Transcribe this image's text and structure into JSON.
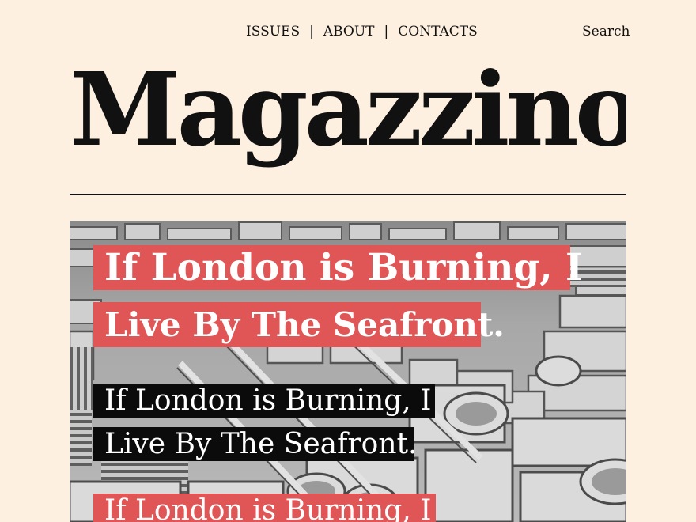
{
  "nav": {
    "links": [
      "ISSUES",
      "ABOUT",
      "CONTACTS"
    ],
    "separator": "|",
    "search_label": "Search"
  },
  "brand": {
    "title": "Magazzino"
  },
  "article": {
    "headline_line1": "If London is Burning, I",
    "headline_line2": "Live By The Seafront."
  },
  "colors": {
    "background": "#fdf0e0",
    "highlight_red": "#e05656",
    "highlight_black": "#0b0b0b",
    "text": "#111111"
  }
}
